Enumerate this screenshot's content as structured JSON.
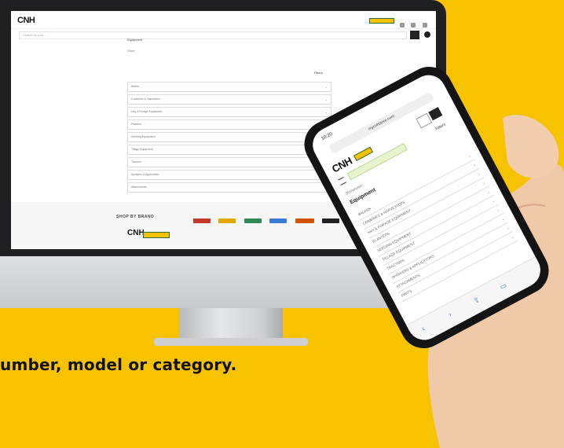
{
  "desktop": {
    "search_placeholder": "Search by part...",
    "crumb": "Equipment",
    "sub_label": "Store",
    "filter_label": "Filters",
    "categories": [
      "Balers",
      "Combines & Harvesters",
      "Hay & Forage Equipment",
      "Planters",
      "Seeding Equipment",
      "Tillage Equipment",
      "Tractors",
      "Sprayers & Applicators",
      "Attachments"
    ],
    "shop_by_brand": "SHOP BY BRAND",
    "brand_colors": [
      "#c0392b",
      "#e0a800",
      "#2e8b57",
      "#3a7bd5",
      "#d35400",
      "#222222"
    ]
  },
  "logo_text": "CNH",
  "caption": "umber, model or category.",
  "phone": {
    "time": "10:20",
    "url": "mycnhstore.com",
    "crumb": "Showroom",
    "title": "Equipment",
    "filter_label": "Filters",
    "categories": [
      "BALERS",
      "COMBINES & HARVESTERS",
      "HAY & FORAGE EQUIPMENT",
      "PLANTERS",
      "SEEDING EQUIPMENT",
      "TILLAGE EQUIPMENT",
      "TRACTORS",
      "SPRAYERS & APPLICATORS",
      "ATTACHMENTS",
      "PARTS"
    ]
  },
  "colors": {
    "background": "#f7c300",
    "monitor_bezel": "#1f1f21",
    "accent_green": "#2a6e3a"
  }
}
